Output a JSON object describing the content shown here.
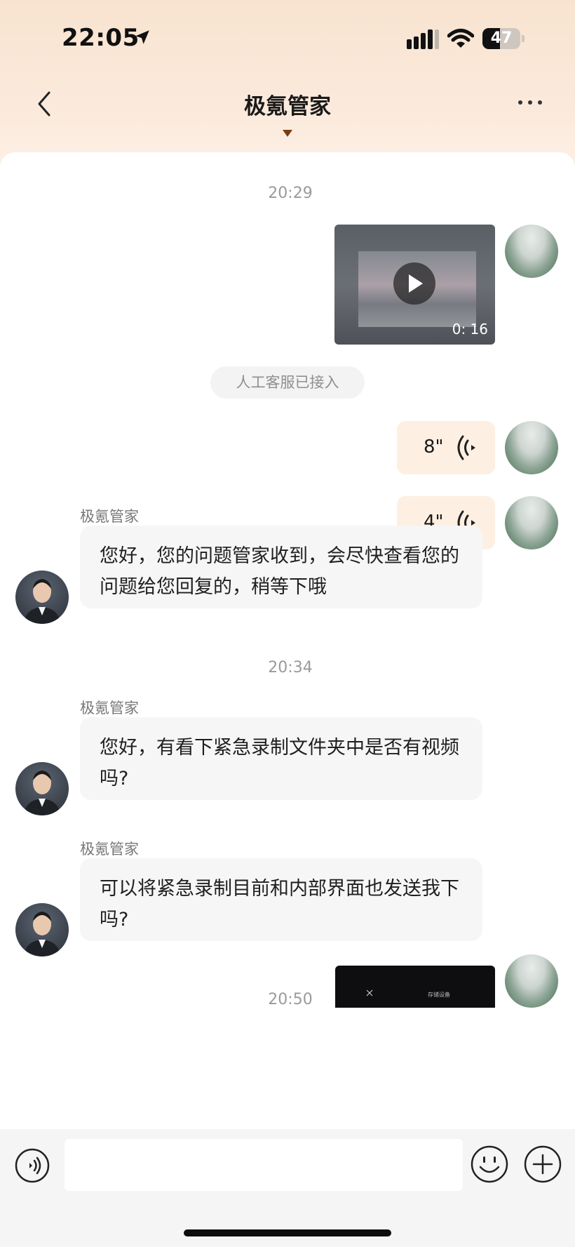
{
  "status_bar": {
    "time": "22:05",
    "battery": "47",
    "battery_fraction": 0.47
  },
  "navbar": {
    "title": "极氪管家"
  },
  "messages": {
    "ts1": "20:29",
    "video_duration": "0: 16",
    "system_notice": "人工客服已接入",
    "voice1_seconds": "8\"",
    "voice2_seconds": "4\"",
    "agent_name": "极氪管家",
    "agent_msg1": "您好，您的问题管家收到，会尽快查看您的问题给您回复的，稍等下哦",
    "ts2": "20:34",
    "agent_msg2": "您好，有看下紧急录制文件夹中是否有视频吗?",
    "agent_msg3": "可以将紧急录制目前和内部界面也发送我下吗?",
    "ts3": "20:50",
    "partial_image_caption": "存储设备"
  },
  "icons": {
    "back": "chevron-left-icon",
    "more": "ellipsis-icon",
    "play": "play-icon",
    "voice_wave": "voice-wave-icon",
    "voice_input": "voice-input-icon",
    "emoji": "emoji-icon",
    "plus": "plus-icon"
  },
  "colors": {
    "accent_bubble": "#fdf0e3",
    "header_bg": "#f8e3cf"
  }
}
